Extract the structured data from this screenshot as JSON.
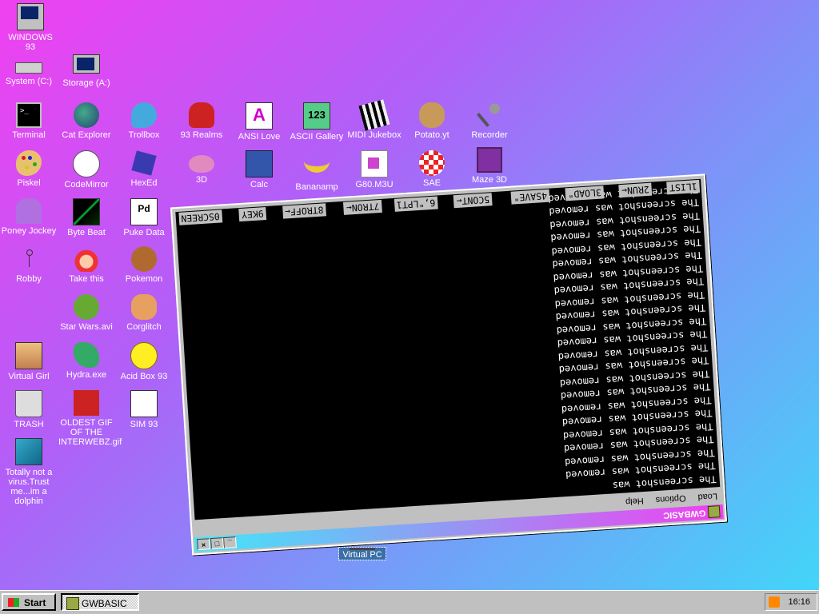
{
  "desktop": {
    "icons": [
      {
        "id": "windows93",
        "label": "WINDOWS 93"
      },
      {
        "id": "system",
        "label": "System (C:)"
      },
      {
        "id": "storage",
        "label": "Storage (A:)"
      },
      {
        "id": "terminal",
        "label": "Terminal"
      },
      {
        "id": "cat-explorer",
        "label": "Cat Explorer"
      },
      {
        "id": "trollbox",
        "label": "Trollbox"
      },
      {
        "id": "realms",
        "label": "93 Realms"
      },
      {
        "id": "ansi-love",
        "label": "ANSI Love"
      },
      {
        "id": "ascii-gallery",
        "label": "ASCII Gallery"
      },
      {
        "id": "midi-jukebox",
        "label": "MIDI Jukebox"
      },
      {
        "id": "potato",
        "label": "Potato.yt"
      },
      {
        "id": "recorder",
        "label": "Recorder"
      },
      {
        "id": "piskel",
        "label": "Piskel"
      },
      {
        "id": "codemirror",
        "label": "CodeMirror"
      },
      {
        "id": "hexed",
        "label": "HexEd"
      },
      {
        "id": "3d",
        "label": "3D"
      },
      {
        "id": "calc",
        "label": "Calc"
      },
      {
        "id": "bananamp",
        "label": "Bananamp"
      },
      {
        "id": "g80",
        "label": "G80.M3U"
      },
      {
        "id": "sae",
        "label": "SAE"
      },
      {
        "id": "maze",
        "label": "Maze 3D"
      },
      {
        "id": "poney",
        "label": "Poney Jockey"
      },
      {
        "id": "bytebeat",
        "label": "Byte Beat"
      },
      {
        "id": "puke",
        "label": "Puke Data"
      },
      {
        "id": "robby",
        "label": "Robby"
      },
      {
        "id": "take-this",
        "label": "Take this"
      },
      {
        "id": "pokemon",
        "label": "Pokemon"
      },
      {
        "id": "starwars",
        "label": "Star Wars.avi"
      },
      {
        "id": "corglitch",
        "label": "Corglitch"
      },
      {
        "id": "virtual-girl",
        "label": "Virtual Girl"
      },
      {
        "id": "hydra",
        "label": "Hydra.exe"
      },
      {
        "id": "acid",
        "label": "Acid Box 93"
      },
      {
        "id": "trash",
        "label": "TRASH"
      },
      {
        "id": "oldest-gif",
        "label": "OLDEST GIF OF THE INTERWEBZ.gif"
      },
      {
        "id": "sim93",
        "label": "SIM 93"
      },
      {
        "id": "dolphin",
        "label": "Totally not a virus.Trust me...im a dolphin"
      }
    ],
    "virtual_pc": {
      "label": "Virtual PC"
    }
  },
  "gwbasic": {
    "title": "GWBASIC",
    "menu": [
      "Load",
      "Options",
      "Help"
    ],
    "screen_line_first": "The screenshot was",
    "screen_line": "The screenshot was removed",
    "fkeys": [
      "1LIST",
      "2RUN←",
      "3LOAD\"",
      "4SAVE\"",
      "5CONT←",
      "6,\"LPT1",
      "7TRON←",
      "8TROFF←",
      "9KEY",
      "0SCREEN"
    ]
  },
  "taskbar": {
    "start_label": "Start",
    "tasks": [
      {
        "label": "GWBASIC"
      }
    ],
    "clock": "16:16"
  },
  "colors": {
    "bg_top_left": "#f040f0",
    "bg_bottom_right": "#40d8f8",
    "window_gray": "#c0c0c0",
    "screen_black": "#000000"
  }
}
